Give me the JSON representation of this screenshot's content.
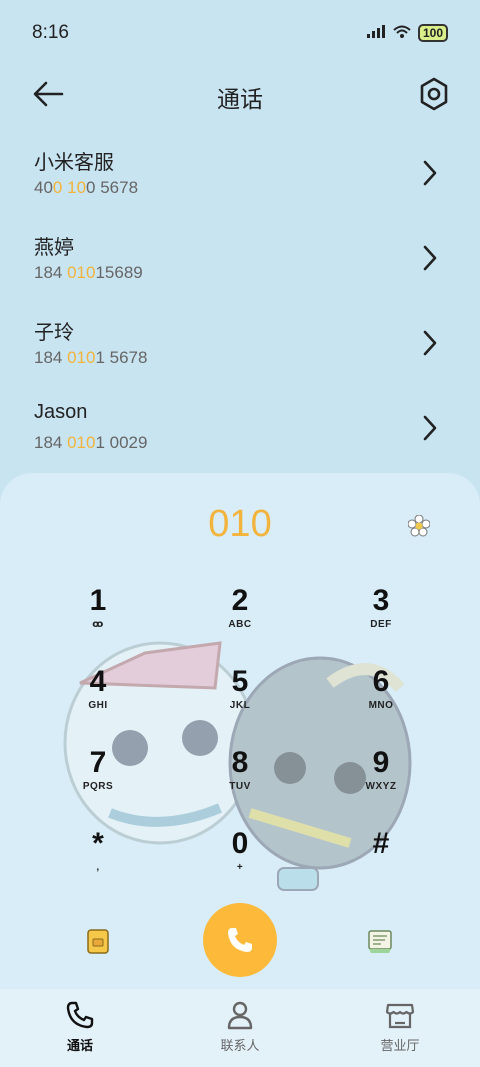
{
  "status_bar": {
    "time": "8:16",
    "signal_text": "000",
    "battery": "100"
  },
  "header": {
    "title": "通话"
  },
  "results": [
    {
      "name": "小米客服",
      "number_parts": [
        {
          "t": "40",
          "h": false
        },
        {
          "t": "0",
          "h": true
        },
        {
          "t": " ",
          "h": false
        },
        {
          "t": "10",
          "h": true
        },
        {
          "t": "0 5678",
          "h": false
        }
      ]
    },
    {
      "name": "燕婷",
      "number_parts": [
        {
          "t": "184 ",
          "h": false
        },
        {
          "t": "010",
          "h": true
        },
        {
          "t": "15689",
          "h": false
        }
      ]
    },
    {
      "name": "子玲",
      "number_parts": [
        {
          "t": "184 ",
          "h": false
        },
        {
          "t": "010",
          "h": true
        },
        {
          "t": "1 5678",
          "h": false
        }
      ]
    },
    {
      "name": "Jason",
      "number_parts": [
        {
          "t": "184 ",
          "h": false
        },
        {
          "t": "010",
          "h": true
        },
        {
          "t": "1 0029",
          "h": false
        }
      ]
    }
  ],
  "dialer": {
    "input": "010",
    "keys": [
      {
        "digit": "1",
        "letters": "ꝏ"
      },
      {
        "digit": "2",
        "letters": "ABC"
      },
      {
        "digit": "3",
        "letters": "DEF"
      },
      {
        "digit": "4",
        "letters": "GHI"
      },
      {
        "digit": "5",
        "letters": "JKL"
      },
      {
        "digit": "6",
        "letters": "MNO"
      },
      {
        "digit": "7",
        "letters": "PQRS"
      },
      {
        "digit": "8",
        "letters": "TUV"
      },
      {
        "digit": "9",
        "letters": "WXYZ"
      },
      {
        "digit": "*",
        "letters": ","
      },
      {
        "digit": "0",
        "letters": "+"
      },
      {
        "digit": "#",
        "letters": ""
      }
    ]
  },
  "bottom_nav": {
    "items": [
      {
        "label": "通话",
        "icon": "phone-icon",
        "active": true
      },
      {
        "label": "联系人",
        "icon": "person-icon",
        "active": false
      },
      {
        "label": "营业厅",
        "icon": "store-icon",
        "active": false
      }
    ]
  },
  "colors": {
    "accent": "#f2b43c",
    "call_button": "#fcb93a",
    "background": "#c9e4f1",
    "dialer_panel": "#d8edf8"
  }
}
